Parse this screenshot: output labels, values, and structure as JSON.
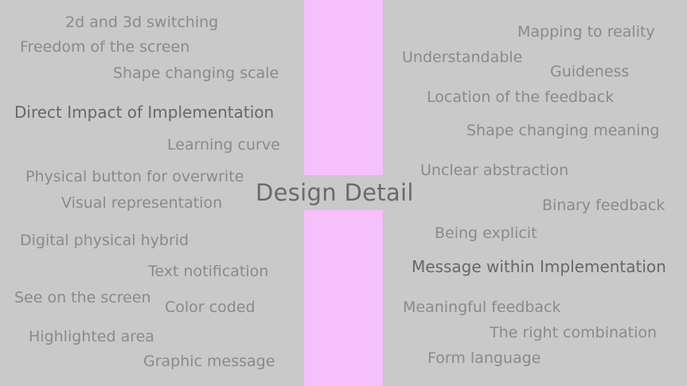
{
  "title": "Design Detail",
  "colors": {
    "background": "#c8c9c8",
    "center_bar": "#f5c0fb",
    "text": "#8a8a8a",
    "text_emphasis": "#686868"
  },
  "left_phrases": [
    "2d and 3d switching",
    "Freedom of the screen",
    "Shape changing scale",
    "Direct Impact of Implementation",
    "Learning curve",
    "Physical button for overwrite",
    "Visual representation",
    "Digital physical hybrid",
    "Text notification",
    "See on the screen",
    "Color coded",
    "Highlighted area",
    "Graphic message"
  ],
  "right_phrases": [
    "Mapping to reality",
    "Understandable",
    "Guideness",
    "Location of  the feedback",
    "Shape changing meaning",
    "Unclear abstraction",
    "Binary feedback",
    "Being explicit",
    "Message within Implementation",
    "Meaningful feedback",
    "The right combination",
    "Form language"
  ]
}
